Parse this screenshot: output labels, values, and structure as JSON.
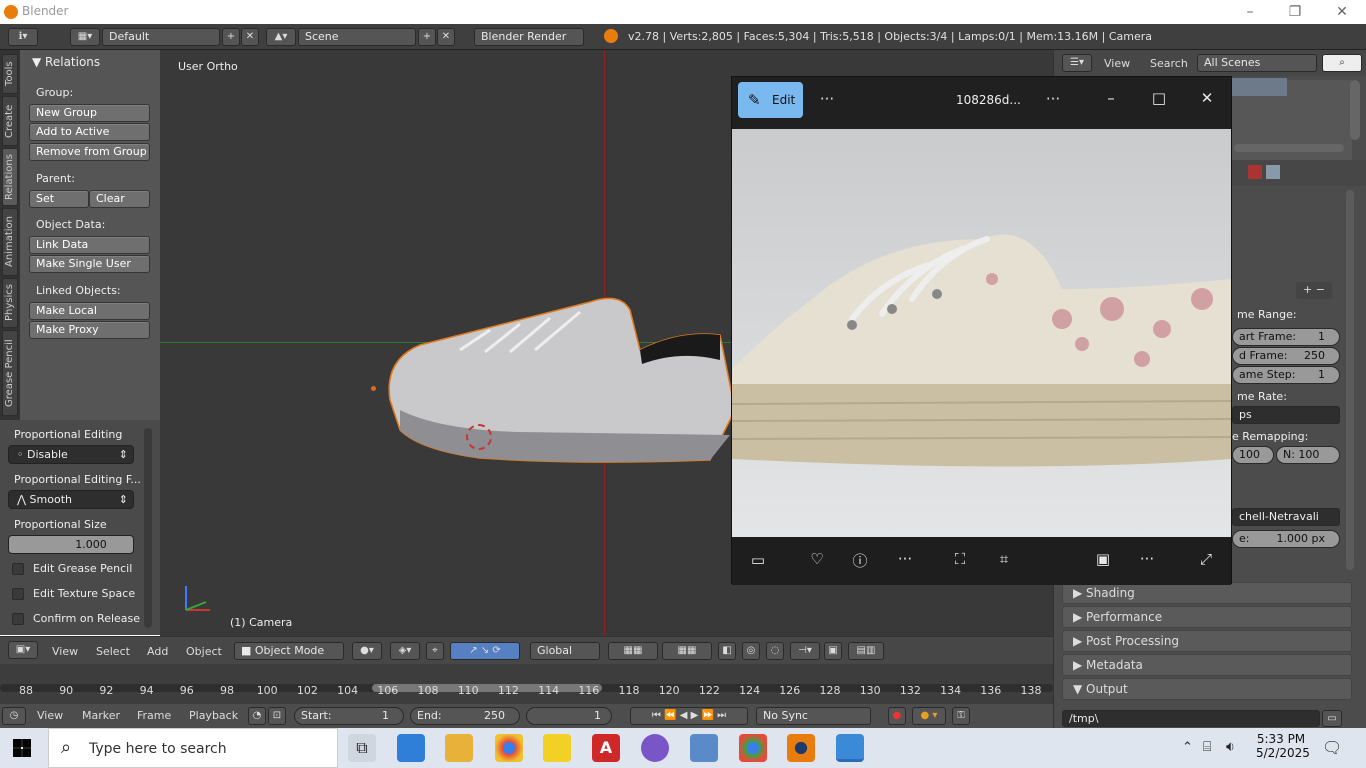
{
  "app": {
    "title": "Blender"
  },
  "infobar": {
    "layout": "Default",
    "scene": "Scene",
    "engine": "Blender Render",
    "stats": "v2.78 | Verts:2,805 | Faces:5,304 | Tris:5,518 | Objects:3/4 | Lamps:0/1 | Mem:13.16M | Camera"
  },
  "tabs": [
    "Tools",
    "Create",
    "Relations",
    "Animation",
    "Physics",
    "Grease Pencil"
  ],
  "relations": {
    "title": "Relations",
    "group_label": "Group:",
    "new_group": "New Group",
    "add_to_active": "Add to Active",
    "remove_from_group": "Remove from Group",
    "parent_label": "Parent:",
    "set": "Set",
    "clear": "Clear",
    "object_data_label": "Object Data:",
    "link_data": "Link Data",
    "make_single_user": "Make Single User",
    "linked_objects_label": "Linked Objects:",
    "make_local": "Make Local",
    "make_proxy": "Make Proxy"
  },
  "operator": {
    "prop_edit_label": "Proportional Editing",
    "prop_edit_value": "Disable",
    "falloff_label": "Proportional Editing F...",
    "falloff_value": "Smooth",
    "size_label": "Proportional Size",
    "size_value": "1.000",
    "grease_pencil": "Edit Grease Pencil",
    "texture_space": "Edit Texture Space",
    "confirm_release": "Confirm on Release"
  },
  "viewport": {
    "view_label": "User Ortho",
    "object_label": "(1) Camera"
  },
  "view3d_header": {
    "view": "View",
    "select": "Select",
    "add": "Add",
    "object": "Object",
    "mode": "Object Mode",
    "orientation": "Global"
  },
  "ruler": [
    "88",
    "90",
    "92",
    "94",
    "96",
    "98",
    "100",
    "102",
    "104",
    "106",
    "108",
    "110",
    "112",
    "114",
    "116",
    "118",
    "120",
    "122",
    "124",
    "126",
    "128",
    "130",
    "132",
    "134",
    "136",
    "138"
  ],
  "timeline": {
    "view": "View",
    "marker": "Marker",
    "frame": "Frame",
    "playback": "Playback",
    "start_label": "Start:",
    "start_value": "1",
    "end_label": "End:",
    "end_value": "250",
    "current": "1",
    "sync": "No Sync"
  },
  "properties": {
    "view": "View",
    "search": "Search",
    "scenes": "All Scenes",
    "frame_range": "me Range:",
    "start_frame": "art Frame:",
    "start_frame_val": "1",
    "end_frame": "d Frame:",
    "end_frame_val": "250",
    "frame_step": "ame Step:",
    "frame_step_val": "1",
    "frame_rate": "me Rate:",
    "fps": "ps",
    "remapping": "e Remapping:",
    "remap_old": "100",
    "remap_new": "N: 100",
    "filter": "chell-Netravali",
    "filter_size": "1.000 px",
    "filter_size_label": "e:",
    "sections": [
      "Shading",
      "Performance",
      "Post Processing",
      "Metadata",
      "Output"
    ],
    "output_path": "/tmp\\"
  },
  "photos": {
    "edit": "Edit",
    "filename": "108286d..."
  },
  "taskbar": {
    "search_placeholder": "Type here to search",
    "time": "5:33 PM",
    "date": "5/2/2025"
  }
}
